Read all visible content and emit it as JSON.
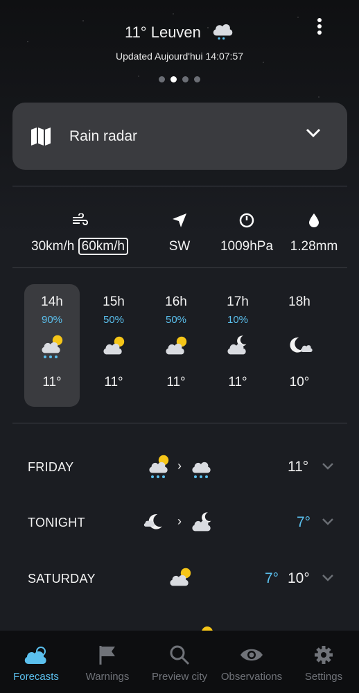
{
  "header": {
    "temp_city": "11° Leuven",
    "updated": "Updated Aujourd'hui 14:07:57",
    "page_dots": 4,
    "active_dot": 1
  },
  "radar": {
    "label": "Rain radar"
  },
  "stats": {
    "wind": "30km/h",
    "gust": "60km/h",
    "direction": "SW",
    "pressure": "1009hPa",
    "precipitation": "1.28mm"
  },
  "hourly": [
    {
      "time": "14h",
      "precip": "90%",
      "temp": "11°",
      "icon": "rain-sun"
    },
    {
      "time": "15h",
      "precip": "50%",
      "temp": "11°",
      "icon": "cloud-sun"
    },
    {
      "time": "16h",
      "precip": "50%",
      "temp": "11°",
      "icon": "cloud-sun"
    },
    {
      "time": "17h",
      "precip": "10%",
      "temp": "11°",
      "icon": "cloud-moon"
    },
    {
      "time": "18h",
      "precip": "",
      "temp": "10°",
      "icon": "moon-cloud"
    }
  ],
  "daily": [
    {
      "name": "FRIDAY",
      "low": "",
      "high": "11°"
    },
    {
      "name": "TONIGHT",
      "low": "7°",
      "high": ""
    },
    {
      "name": "SATURDAY",
      "low": "7°",
      "high": "10°"
    }
  ],
  "nav": [
    {
      "label": "Forecasts",
      "icon": "forecast-icon"
    },
    {
      "label": "Warnings",
      "icon": "flag-icon"
    },
    {
      "label": "Preview city",
      "icon": "search-icon"
    },
    {
      "label": "Observations",
      "icon": "eye-icon"
    },
    {
      "label": "Settings",
      "icon": "gear-icon"
    }
  ],
  "colors": {
    "accent": "#5bc0ee",
    "background": "#1b1d22",
    "card": "#3a3b3f"
  }
}
